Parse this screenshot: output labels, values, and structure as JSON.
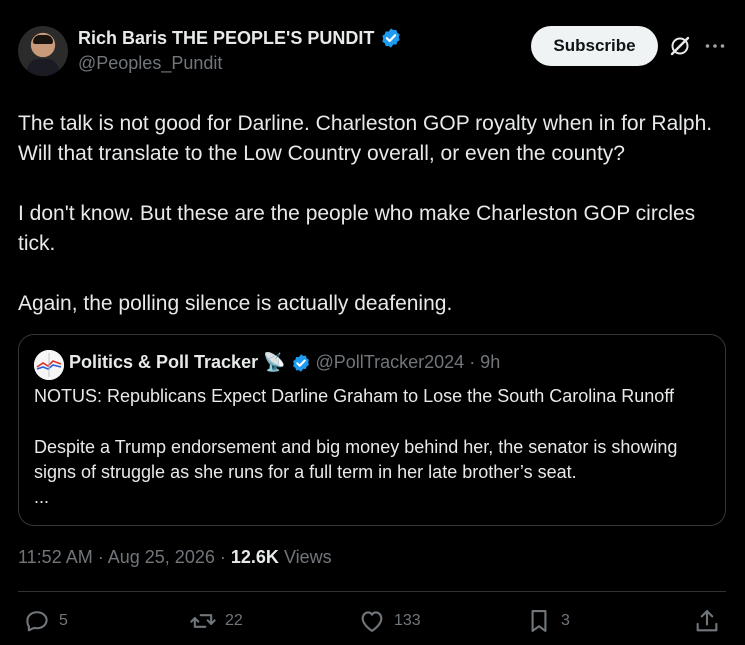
{
  "author": {
    "name": "Rich Baris THE PEOPLE'S PUNDIT",
    "handle": "@Peoples_Pundit",
    "verified": true
  },
  "header": {
    "subscribe_label": "Subscribe",
    "icons": [
      "grok-icon",
      "more-icon"
    ]
  },
  "tweet": {
    "paragraphs": [
      "The talk is not good for Darline. Charleston GOP royalty when in for Ralph. Will that translate to the Low Country overall, or even the county?",
      "I don't know. But these are the people who make Charleston GOP circles tick.",
      "Again, the polling silence is actually deafening."
    ]
  },
  "quote": {
    "name": "Politics & Poll Tracker",
    "emoji": "📡",
    "handle": "@PollTracker2024",
    "time": "· 9h",
    "title": "NOTUS: Republicans Expect Darline Graham to Lose the South Carolina Runoff",
    "description": "Despite a Trump endorsement and big money behind her, the senator is showing signs of struggle as she runs for a full term in her late brother’s seat.",
    "ellipsis": "..."
  },
  "meta": {
    "time": "11:52 AM",
    "date": "Aug 25, 2026",
    "views_count": "12.6K",
    "views_label": "Views"
  },
  "actions": {
    "replies": "5",
    "reposts": "22",
    "likes": "133",
    "bookmarks": "3"
  },
  "colors": {
    "background": "#000000",
    "text": "#e7e9ea",
    "muted": "#71767b",
    "verified": "#1d9bf0",
    "border": "#333639"
  }
}
